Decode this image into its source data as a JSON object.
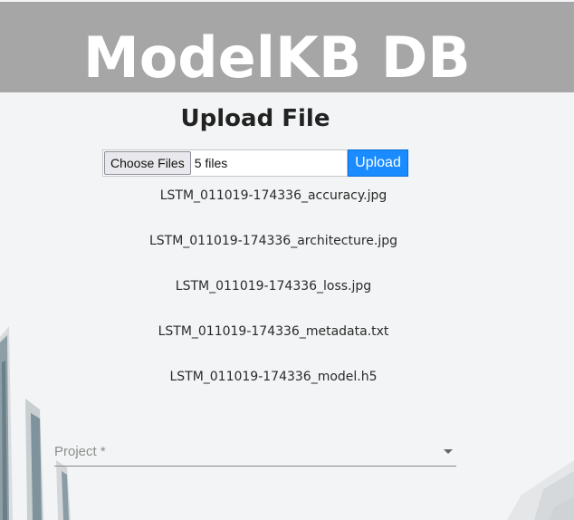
{
  "header": {
    "title": "ModelKB DB"
  },
  "page": {
    "title": "Upload File"
  },
  "upload": {
    "choose_label": "Choose Files",
    "file_count": "5 files",
    "upload_label": "Upload"
  },
  "files": [
    "LSTM_011019-174336_accuracy.jpg",
    "LSTM_011019-174336_architecture.jpg",
    "LSTM_011019-174336_loss.jpg",
    "LSTM_011019-174336_metadata.txt",
    "LSTM_011019-174336_model.h5"
  ],
  "project_select": {
    "label": "Project *"
  },
  "colors": {
    "header_bg": "#a6a6a6",
    "accent": "#1a8cff",
    "page_bg": "#f3f4f5"
  }
}
